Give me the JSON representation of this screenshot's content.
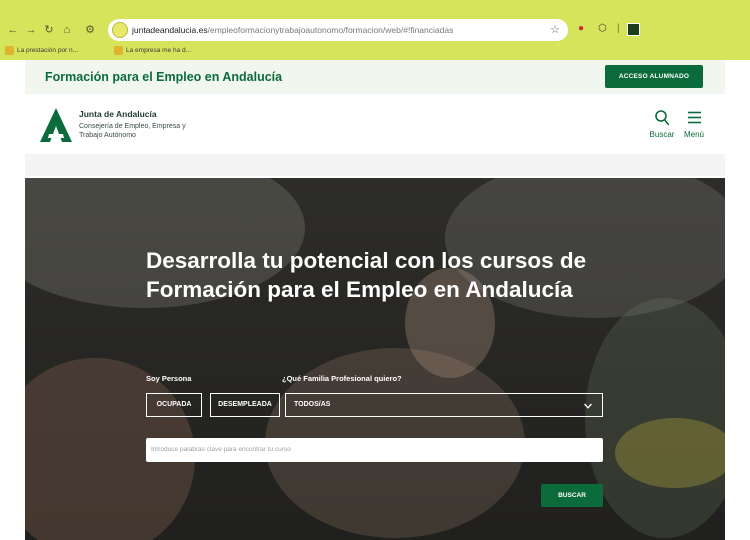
{
  "browser": {
    "url_domain": "juntadeandalucia.es",
    "url_path": "/empleoformacionytrabajoautonomo/formacion/web/#!financiadas",
    "bookmarks": [
      {
        "label": "La prestación por n..."
      },
      {
        "label": "La empresa me ha d..."
      }
    ],
    "colors": {
      "chrome": "#d5e45b"
    }
  },
  "site": {
    "topbar_title": "Formación para el Empleo en Andalucía",
    "access_label": "ACCESO ALUMNADO",
    "org_name": "Junta de Andalucía",
    "department": "Consejería de Empleo, Empresa y Trabajo Autónomo",
    "search_label": "Buscar",
    "menu_label": "Menú",
    "colors": {
      "primary": "#0c6b3a",
      "topbar_bg": "#f1f6ef"
    }
  },
  "hero": {
    "title": "Desarrolla tu potencial con los cursos de Formación para el Empleo en Andalucía",
    "persona_label": "Soy Persona",
    "persona_options": [
      "OCUPADA",
      "DESEMPLEADA"
    ],
    "familia_label": "¿Qué Familia Profesional quiero?",
    "familia_selected": "TODOS/AS",
    "keyword_placeholder": "Introduce palabras clave para encontrar tu curso",
    "search_button": "BUSCAR"
  }
}
